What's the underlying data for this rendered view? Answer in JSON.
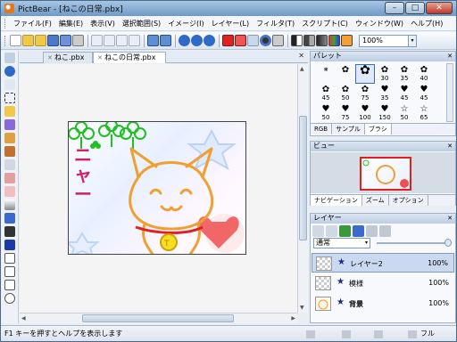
{
  "window": {
    "title": "PictBear - [ねこの日常.pbx]",
    "minimize": "–",
    "maximize": "□",
    "close": "✕"
  },
  "menu": [
    "ファイル(F)",
    "編集(E)",
    "表示(V)",
    "選択範囲(S)",
    "イメージ(I)",
    "レイヤー(L)",
    "フィルタ(T)",
    "スクリプト(C)",
    "ウィンドウ(W)",
    "ヘルプ(H)"
  ],
  "toolbar": {
    "zoom": "100%",
    "zoom_arrow": "▾"
  },
  "doc_tabs": [
    {
      "label": "ねこ.pbx"
    },
    {
      "label": "ねこの日常.pbx"
    }
  ],
  "doc_tab_close": "✕",
  "palette": {
    "title": "パレット",
    "cells": [
      {
        "size": ""
      },
      {
        "size": ""
      },
      {
        "size": ""
      },
      {
        "size": "30"
      },
      {
        "size": "35"
      },
      {
        "size": "40"
      },
      {
        "size": "45"
      },
      {
        "size": "50"
      },
      {
        "size": "75"
      },
      {
        "size": "35"
      },
      {
        "size": "45"
      },
      {
        "size": "45"
      },
      {
        "size": "50"
      },
      {
        "size": "75"
      },
      {
        "size": "100"
      },
      {
        "size": "150"
      },
      {
        "size": "50"
      },
      {
        "size": "65"
      }
    ],
    "tabs": [
      "RGB",
      "サンプル",
      "ブラシ"
    ]
  },
  "view": {
    "title": "ビュー",
    "tabs": [
      "ナビゲーション",
      "ズーム",
      "オプション"
    ]
  },
  "layers": {
    "title": "レイヤー",
    "blend_mode": "通常",
    "items": [
      {
        "name": "レイヤー2",
        "opacity": "100%"
      },
      {
        "name": "模様",
        "opacity": "100%"
      },
      {
        "name": "背景",
        "opacity": "100%"
      }
    ]
  },
  "canvas_text": "ニャー",
  "status": {
    "help": "F1 キーを押すとヘルプを表示します",
    "right": "フル"
  },
  "colors": {
    "accent": "#6f99c6",
    "cat": "#f0a030",
    "text": "#d0206a",
    "leaf": "#20c020"
  }
}
